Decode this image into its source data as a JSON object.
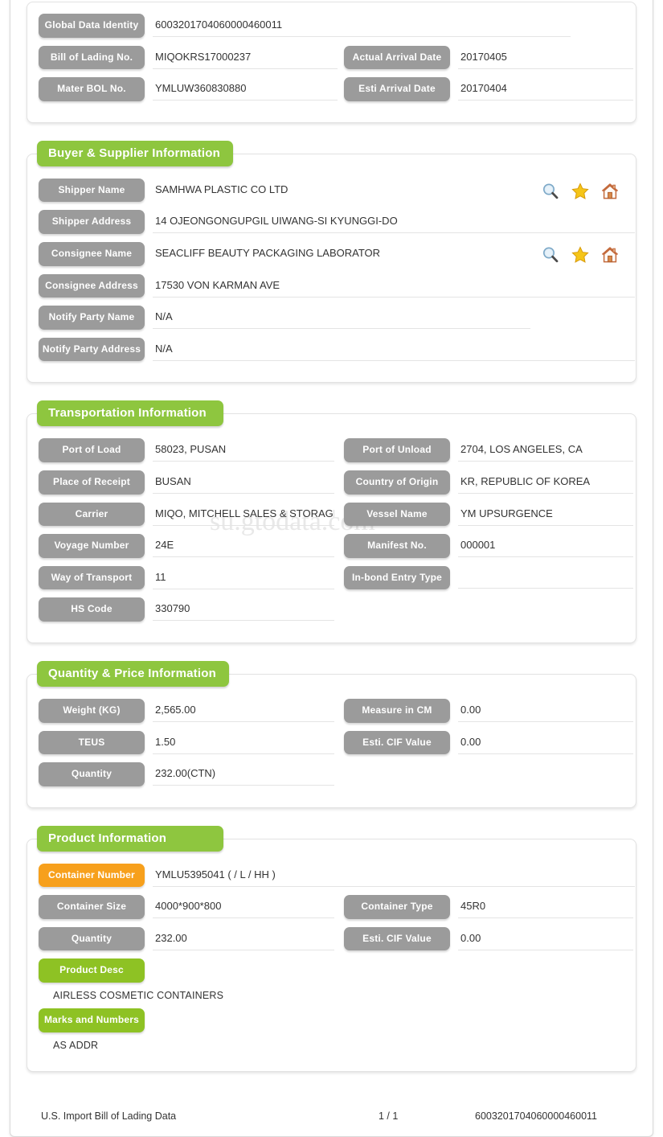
{
  "watermark": "su.gtodata.com",
  "header_section": {
    "rows": [
      {
        "label": "Global Data Identity",
        "value": "6003201704060000460011"
      },
      {
        "label": "Bill of Lading No.",
        "value": "MIQOKRS17000237",
        "label2": "Actual Arrival Date",
        "value2": "20170405"
      },
      {
        "label": "Mater BOL No.",
        "value": "YMLUW360830880",
        "label2": "Esti Arrival Date",
        "value2": "20170404"
      }
    ]
  },
  "buyer_supplier": {
    "title": "Buyer & Supplier Information",
    "shipper_name_label": "Shipper Name",
    "shipper_name_value": "SAMHWA PLASTIC CO LTD",
    "shipper_address_label": "Shipper Address",
    "shipper_address_value": "14 OJEONGONGUPGIL UIWANG-SI KYUNGGI-DO",
    "consignee_name_label": "Consignee Name",
    "consignee_name_value": "SEACLIFF BEAUTY PACKAGING LABORATOR",
    "consignee_address_label": "Consignee Address",
    "consignee_address_value": "17530 VON KARMAN AVE",
    "notify_party_name_label": "Notify Party Name",
    "notify_party_name_value": "N/A",
    "notify_party_address_label": "Notify Party Address",
    "notify_party_address_value": "N/A",
    "icons": [
      "search-icon",
      "star-icon",
      "home-icon"
    ]
  },
  "transportation": {
    "title": "Transportation Information",
    "port_of_load_label": "Port of Load",
    "port_of_load_value": "58023, PUSAN",
    "port_of_unload_label": "Port of Unload",
    "port_of_unload_value": "2704, LOS ANGELES, CA",
    "place_of_receipt_label": "Place of Receipt",
    "place_of_receipt_value": "BUSAN",
    "country_of_origin_label": "Country of Origin",
    "country_of_origin_value": "KR, REPUBLIC OF KOREA",
    "carrier_label": "Carrier",
    "carrier_value": "MIQO, MITCHELL SALES & STORAGE I",
    "vessel_name_label": "Vessel Name",
    "vessel_name_value": "YM UPSURGENCE",
    "voyage_number_label": "Voyage Number",
    "voyage_number_value": "24E",
    "manifest_no_label": "Manifest No.",
    "manifest_no_value": "000001",
    "way_of_transport_label": "Way of Transport",
    "way_of_transport_value": "11",
    "inbond_entry_type_label": "In-bond Entry Type",
    "inbond_entry_type_value": "",
    "hs_code_label": "HS Code",
    "hs_code_value": "330790"
  },
  "quantity_price": {
    "title": "Quantity & Price Information",
    "weight_label": "Weight (KG)",
    "weight_value": "2,565.00",
    "measure_label": "Measure in CM",
    "measure_value": "0.00",
    "teus_label": "TEUS",
    "teus_value": "1.50",
    "cif_label": "Esti. CIF Value",
    "cif_value": "0.00",
    "quantity_label": "Quantity",
    "quantity_value": "232.00(CTN)"
  },
  "product": {
    "title": "Product Information",
    "container_number_label": "Container Number",
    "container_number_value": "YMLU5395041 ( / L / HH )",
    "container_size_label": "Container Size",
    "container_size_value": "4000*900*800",
    "container_type_label": "Container Type",
    "container_type_value": "45R0",
    "quantity_label": "Quantity",
    "quantity_value": "232.00",
    "cif_label": "Esti. CIF Value",
    "cif_value": "0.00",
    "product_desc_label": "Product Desc",
    "product_desc_value": "AIRLESS COSMETIC CONTAINERS",
    "marks_label": "Marks and Numbers",
    "marks_value": "AS ADDR"
  },
  "footer": {
    "left": "U.S. Import Bill of Lading Data",
    "page": "1 / 1",
    "right": "6003201704060000460011"
  },
  "colors": {
    "green": "#8ec63f",
    "green_btn": "#8ec224",
    "orange": "#f7a01c",
    "gray_pill": "#9b9b9b",
    "text": "#333333"
  }
}
